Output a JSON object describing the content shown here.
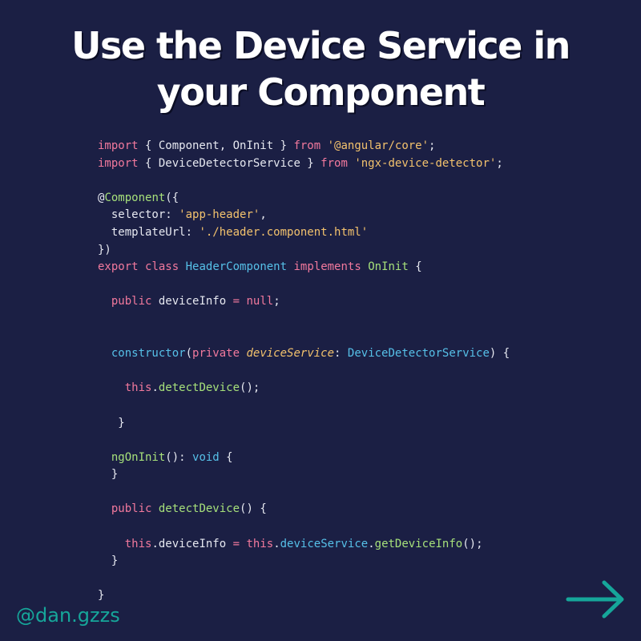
{
  "title": {
    "line1": "Use the Device Service in",
    "line2": "your Component"
  },
  "code": {
    "lines": [
      [
        [
          "kw",
          "import"
        ],
        [
          "p",
          " { Component, OnInit } "
        ],
        [
          "kw",
          "from"
        ],
        [
          "p",
          " "
        ],
        [
          "str",
          "'@angular/core'"
        ],
        [
          "p",
          ";"
        ]
      ],
      [
        [
          "kw",
          "import"
        ],
        [
          "p",
          " { DeviceDetectorService } "
        ],
        [
          "kw",
          "from"
        ],
        [
          "p",
          " "
        ],
        [
          "str",
          "'ngx-device-detector'"
        ],
        [
          "p",
          ";"
        ]
      ],
      [],
      [
        [
          "p",
          "@"
        ],
        [
          "deco",
          "Component"
        ],
        [
          "p",
          "({"
        ]
      ],
      [
        [
          "p",
          "  selector: "
        ],
        [
          "str",
          "'app-header'"
        ],
        [
          "p",
          ","
        ]
      ],
      [
        [
          "p",
          "  templateUrl: "
        ],
        [
          "str",
          "'./header.component.html'"
        ]
      ],
      [
        [
          "p",
          "})"
        ]
      ],
      [
        [
          "kw",
          "export"
        ],
        [
          "p",
          " "
        ],
        [
          "kw",
          "class"
        ],
        [
          "p",
          " "
        ],
        [
          "cls",
          "HeaderComponent"
        ],
        [
          "p",
          " "
        ],
        [
          "kw",
          "implements"
        ],
        [
          "p",
          " "
        ],
        [
          "fn",
          "OnInit"
        ],
        [
          "p",
          " {"
        ]
      ],
      [],
      [
        [
          "p",
          "  "
        ],
        [
          "kw",
          "public"
        ],
        [
          "p",
          " deviceInfo "
        ],
        [
          "op",
          "="
        ],
        [
          "p",
          " "
        ],
        [
          "kw",
          "null"
        ],
        [
          "p",
          ";"
        ]
      ],
      [],
      [],
      [
        [
          "p",
          "  "
        ],
        [
          "cls",
          "constructor"
        ],
        [
          "p",
          "("
        ],
        [
          "kw",
          "private"
        ],
        [
          "p",
          " "
        ],
        [
          "ital",
          "deviceService"
        ],
        [
          "p",
          ": "
        ],
        [
          "cls",
          "DeviceDetectorService"
        ],
        [
          "p",
          ") {"
        ]
      ],
      [],
      [
        [
          "p",
          "    "
        ],
        [
          "kw",
          "this"
        ],
        [
          "p",
          "."
        ],
        [
          "fn",
          "detectDevice"
        ],
        [
          "p",
          "();"
        ]
      ],
      [],
      [
        [
          "p",
          "   }"
        ]
      ],
      [],
      [
        [
          "p",
          "  "
        ],
        [
          "fn",
          "ngOnInit"
        ],
        [
          "p",
          "(): "
        ],
        [
          "cls",
          "void"
        ],
        [
          "p",
          " {"
        ]
      ],
      [
        [
          "p",
          "  }"
        ]
      ],
      [],
      [
        [
          "p",
          "  "
        ],
        [
          "kw",
          "public"
        ],
        [
          "p",
          " "
        ],
        [
          "fn",
          "detectDevice"
        ],
        [
          "p",
          "() {"
        ]
      ],
      [],
      [
        [
          "p",
          "    "
        ],
        [
          "kw",
          "this"
        ],
        [
          "p",
          ".deviceInfo "
        ],
        [
          "op",
          "="
        ],
        [
          "p",
          " "
        ],
        [
          "kw",
          "this"
        ],
        [
          "p",
          "."
        ],
        [
          "cls",
          "deviceService"
        ],
        [
          "p",
          "."
        ],
        [
          "fn",
          "getDeviceInfo"
        ],
        [
          "p",
          "();"
        ]
      ],
      [
        [
          "p",
          "  }"
        ]
      ],
      [],
      [
        [
          "p",
          "}"
        ]
      ]
    ]
  },
  "handle": "@dan.gzzs",
  "icons": {
    "next": "arrow-right-icon"
  },
  "colors": {
    "background": "#1b1f44",
    "accent": "#16a69a",
    "keyword": "#f2799d",
    "string": "#f3c26d",
    "type": "#56c0e8",
    "function": "#a6e07a"
  }
}
